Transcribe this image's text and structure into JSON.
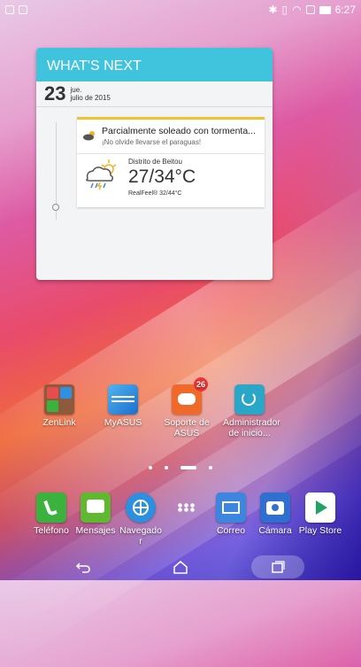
{
  "status_bar": {
    "time": "6:27"
  },
  "widget": {
    "header": "WHAT'S NEXT",
    "date_day": "23",
    "date_weekday": "jue.",
    "date_month_year": "julio de 2015",
    "event_title": "Parcialmente soleado con tormenta...",
    "event_subtitle": "¡No olvide llevarse el paraguas!",
    "location": "Distrito de Beitou",
    "temperature": "27/34°C",
    "realfeel": "RealFeel® 32/44°C"
  },
  "apps": [
    {
      "label": "ZenLink"
    },
    {
      "label": "MyASUS"
    },
    {
      "label": "Soporte de ASUS",
      "badge": "26"
    },
    {
      "label": "Administrador de inicio..."
    }
  ],
  "page_indicator": {
    "pages": 5,
    "active": 3
  },
  "dock": [
    {
      "label": "Teléfono",
      "color": "#3bb23e"
    },
    {
      "label": "Mensajes",
      "color": "#5fb82f"
    },
    {
      "label": "Navegado r",
      "color": "#2c8fe0"
    },
    {
      "label": "",
      "icon": "app-drawer-icon"
    },
    {
      "label": "Correo",
      "color": "#3c86e0"
    },
    {
      "label": "Cámara",
      "color": "#2f6fd0"
    },
    {
      "label": "Play Store",
      "color": "#ffffff"
    }
  ],
  "icons": {
    "zenlink": "folder-icon",
    "myasus": "asus-logo-icon",
    "support": "support-chat-icon",
    "boost": "power-boost-icon"
  }
}
